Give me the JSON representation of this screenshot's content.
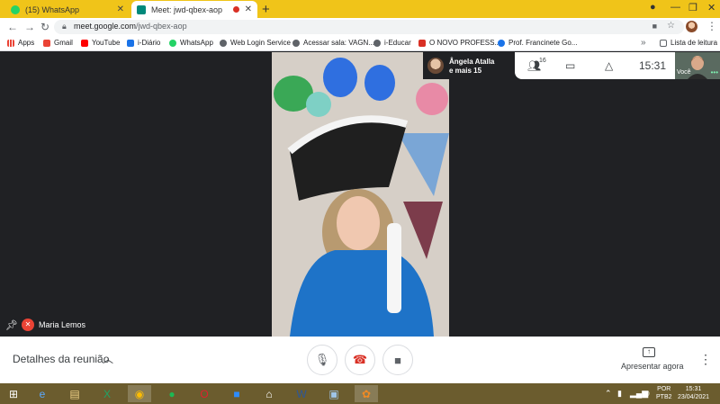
{
  "browser": {
    "tabs": [
      {
        "label": "(15) WhatsApp",
        "color": "#25d366"
      },
      {
        "label": "Meet: jwd-qbex-aop",
        "color": "#00897b"
      }
    ],
    "url_host": "meet.google.com",
    "url_path": "/jwd-qbex-aop",
    "bookmarks": [
      {
        "label": "Apps",
        "color": "#ea4335"
      },
      {
        "label": "Gmail",
        "color": "#ea4335"
      },
      {
        "label": "YouTube",
        "color": "#ff0000"
      },
      {
        "label": "i-Diário",
        "color": "#1a73e8"
      },
      {
        "label": "WhatsApp",
        "color": "#25d366"
      },
      {
        "label": "Web Login Service",
        "color": "#5f6368"
      },
      {
        "label": "Acessar sala: VAGN...",
        "color": "#5f6368"
      },
      {
        "label": "i-Educar",
        "color": "#5f6368"
      },
      {
        "label": "O NOVO PROFESS...",
        "color": "#d93025"
      },
      {
        "label": "Prof. Francinete Go...",
        "color": "#1a73e8"
      }
    ],
    "reading_list": "Lista de leitura"
  },
  "meet": {
    "participant_chip": {
      "name_line1": "Ângela Atalla",
      "name_line2": "e mais 15"
    },
    "people_count": "16",
    "clock": "15:31",
    "self_label": "Você",
    "speaker_name": "Maria Lemos",
    "details_label": "Detalhes da reunião",
    "present_label": "Apresentar agora"
  },
  "taskbar": {
    "lang_line1": "POR",
    "lang_line2": "PTB2",
    "time": "15:31",
    "date": "23/04/2021"
  }
}
